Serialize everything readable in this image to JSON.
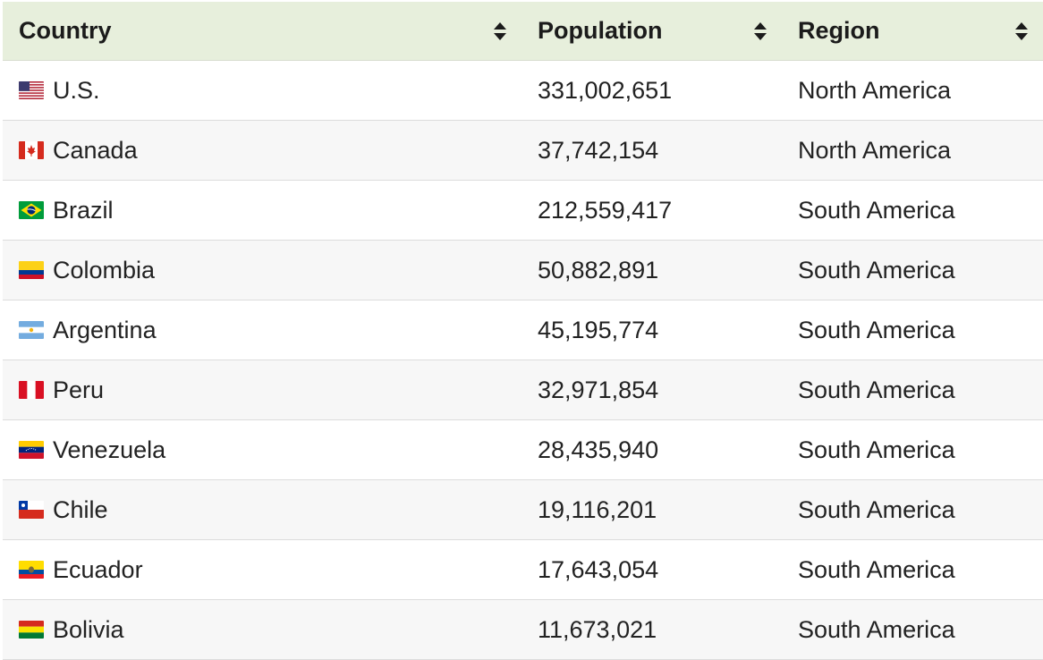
{
  "table": {
    "headers": [
      "Country",
      "Population",
      "Region"
    ],
    "rows": [
      {
        "country": "U.S.",
        "flag": "us-flag-icon",
        "population": "331,002,651",
        "region": "North America"
      },
      {
        "country": "Canada",
        "flag": "canada-flag-icon",
        "population": "37,742,154",
        "region": "North America"
      },
      {
        "country": "Brazil",
        "flag": "brazil-flag-icon",
        "population": "212,559,417",
        "region": "South America"
      },
      {
        "country": "Colombia",
        "flag": "colombia-flag-icon",
        "population": "50,882,891",
        "region": "South America"
      },
      {
        "country": "Argentina",
        "flag": "argentina-flag-icon",
        "population": "45,195,774",
        "region": "South America"
      },
      {
        "country": "Peru",
        "flag": "peru-flag-icon",
        "population": "32,971,854",
        "region": "South America"
      },
      {
        "country": "Venezuela",
        "flag": "venezuela-flag-icon",
        "population": "28,435,940",
        "region": "South America"
      },
      {
        "country": "Chile",
        "flag": "chile-flag-icon",
        "population": "19,116,201",
        "region": "South America"
      },
      {
        "country": "Ecuador",
        "flag": "ecuador-flag-icon",
        "population": "17,643,054",
        "region": "South America"
      },
      {
        "country": "Bolivia",
        "flag": "bolivia-flag-icon",
        "population": "11,673,021",
        "region": "South America"
      }
    ]
  },
  "colors": {
    "header_bg": "#e7efdc",
    "row_alt_bg": "#f7f7f7",
    "border": "#dcdcdc"
  }
}
